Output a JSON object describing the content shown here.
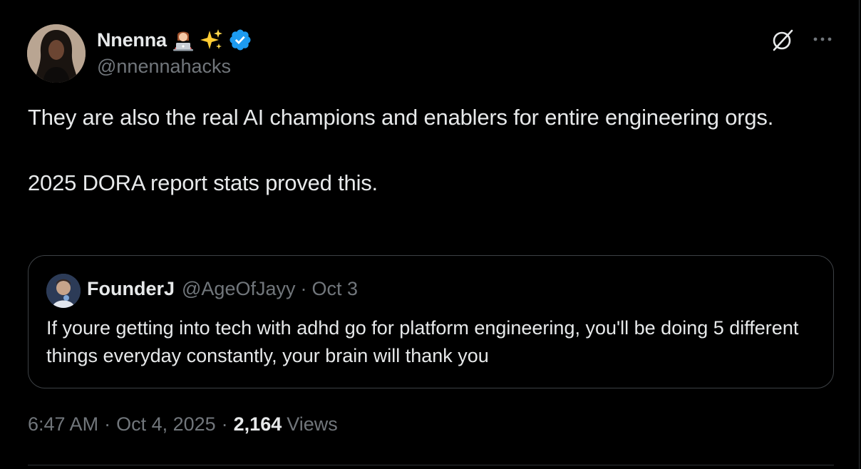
{
  "author": {
    "display_name": "Nnenna",
    "emojis": [
      "woman-technologist-emoji",
      "sparkles-emoji"
    ],
    "verified_badge": "verified-icon",
    "handle": "@nnennahacks"
  },
  "post": {
    "text_line1": "They are also the real AI champions and enablers for entire engineering orgs.",
    "text_line2": "2025 DORA report stats proved this."
  },
  "quoted_post": {
    "display_name": "FounderJ",
    "handle": "@AgeOfJayy",
    "separator": "·",
    "date": "Oct 3",
    "text": "If youre getting into tech with adhd go for platform engineering, you'll be doing 5 different things everyday constantly, your brain will thank you"
  },
  "meta": {
    "time": "6:47 AM",
    "separator": "·",
    "date": "Oct 4, 2025",
    "views_count": "2,164",
    "views_label": "Views"
  },
  "colors": {
    "background": "#000000",
    "primary_text": "#e7e9ea",
    "secondary_text": "#71767b",
    "border": "#2f3336",
    "verified_blue": "#1d9bf0"
  }
}
